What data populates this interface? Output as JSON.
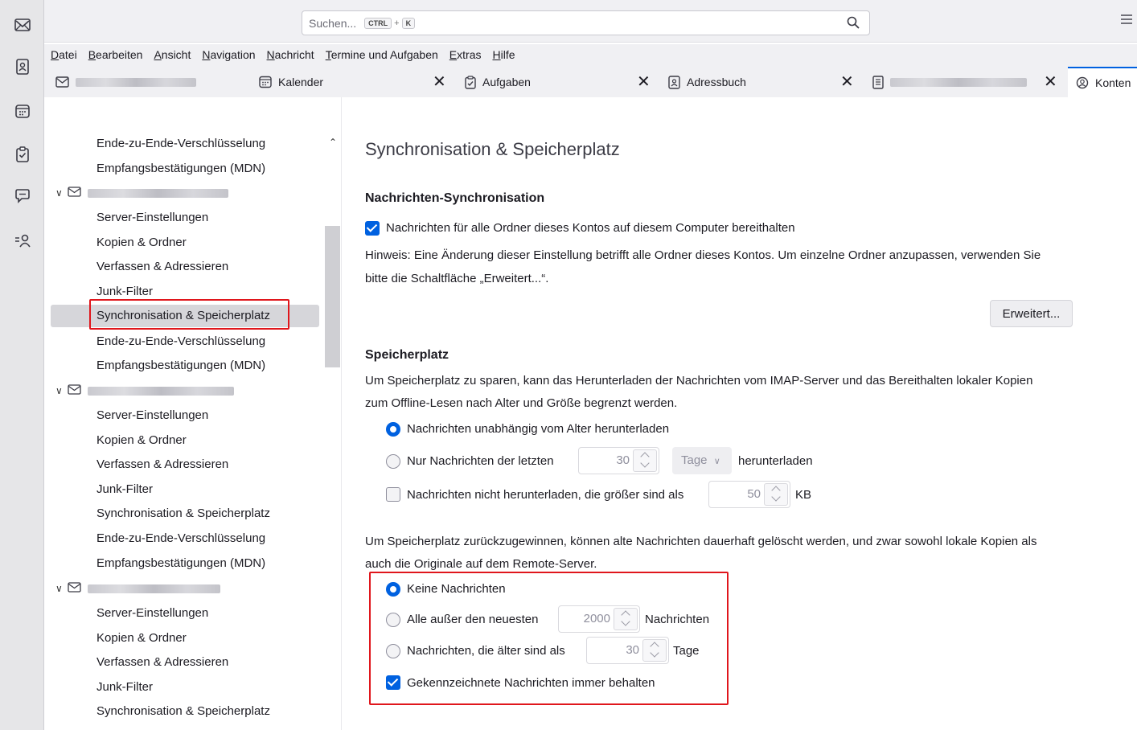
{
  "search": {
    "placeholder": "Suchen...",
    "shortcut_ctrl": "CTRL",
    "shortcut_plus": "+",
    "shortcut_key": "K"
  },
  "menubar": [
    "Datei",
    "Bearbeiten",
    "Ansicht",
    "Navigation",
    "Nachricht",
    "Termine und Aufgaben",
    "Extras",
    "Hilfe"
  ],
  "tabs": {
    "calendar": "Kalender",
    "tasks": "Aufgaben",
    "addressbook": "Adressbuch",
    "settings": "Konten"
  },
  "sidebar": {
    "top_items": [
      "Ende-zu-Ende-Verschlüsselung",
      "Empfangsbestätigungen (MDN)"
    ],
    "account_items": [
      "Server-Einstellungen",
      "Kopien & Ordner",
      "Verfassen & Adressieren",
      "Junk-Filter",
      "Synchronisation & Speicherplatz",
      "Ende-zu-Ende-Verschlüsselung",
      "Empfangsbestätigungen (MDN)"
    ]
  },
  "content": {
    "title": "Synchronisation & Speicherplatz",
    "sync_heading": "Nachrichten-Synchronisation",
    "keep_local_label": "Nachrichten für alle Ordner dieses Kontos auf diesem Computer bereithalten",
    "hint_line1": "Hinweis: Eine Änderung dieser Einstellung betrifft alle Ordner dieses Kontos. Um einzelne Ordner anzupassen, verwenden Sie",
    "hint_line2": "bitte die Schaltfläche „Erweitert...“.",
    "advanced_button": "Erweitert...",
    "storage_heading": "Speicherplatz",
    "storage_desc1": "Um Speicherplatz zu sparen, kann das Herunterladen der Nachrichten vom IMAP-Server und das Bereithalten lokaler Kopien",
    "storage_desc2": "zum Offline-Lesen nach Alter und Größe begrenzt werden.",
    "dl_all_label": "Nachrichten unabhängig vom Alter herunterladen",
    "dl_recent_label": "Nur Nachrichten der letzten",
    "dl_recent_value": "30",
    "dl_recent_unit": "Tage",
    "dl_recent_suffix": "herunterladen",
    "dl_size_label": "Nachrichten nicht herunterladen, die größer sind als",
    "dl_size_value": "50",
    "dl_size_unit": "KB",
    "purge_desc1": "Um Speicherplatz zurückzugewinnen, können alte Nachrichten dauerhaft gelöscht werden, und zwar sowohl lokale Kopien als",
    "purge_desc2": "auch die Originale auf dem Remote-Server.",
    "purge_none_label": "Keine Nachrichten",
    "purge_keep_label": "Alle außer den neuesten",
    "purge_keep_value": "2000",
    "purge_keep_unit": "Nachrichten",
    "purge_older_label": "Nachrichten, die älter sind als",
    "purge_older_value": "30",
    "purge_older_unit": "Tage",
    "keep_flagged_label": "Gekennzeichnete Nachrichten immer behalten"
  }
}
